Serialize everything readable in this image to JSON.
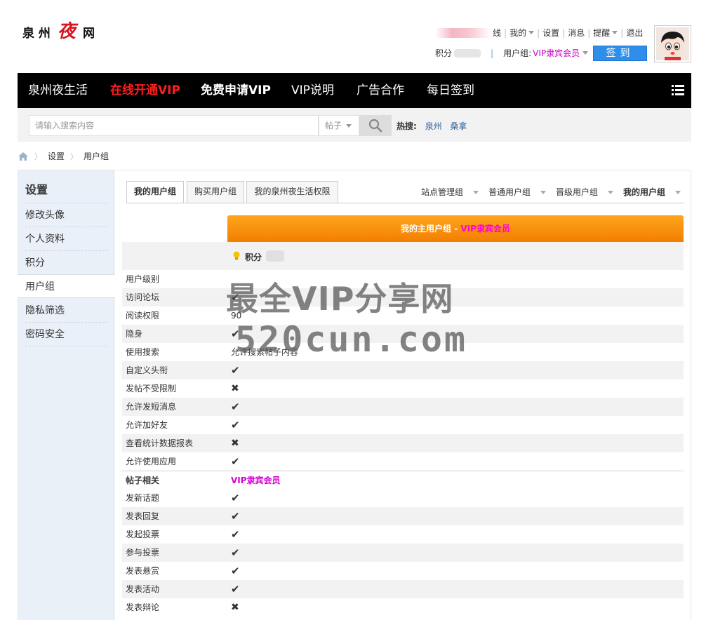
{
  "logo": {
    "part1": "泉 州",
    "part2": "夜",
    "part3": "网"
  },
  "usernav": {
    "online_suffix": "线",
    "items": [
      "我的",
      "设置",
      "消息",
      "提醒",
      "退出"
    ]
  },
  "userinfo": {
    "points_label": "积分",
    "group_label": "用户组: ",
    "group_value": "VIP隶宾会员",
    "signin_label": "签到"
  },
  "navbar": {
    "items": [
      "泉州夜生活",
      "在线开通VIP",
      "免费申请VIP",
      "VIP说明",
      "广告合作",
      "每日签到"
    ]
  },
  "search": {
    "placeholder": "请输入搜索内容",
    "type": "帖子",
    "hot_label": "热搜:",
    "hot_links": [
      "泉州",
      "桑拿"
    ]
  },
  "breadcrumb": [
    "设置",
    "用户组"
  ],
  "sidebar": {
    "title": "设置",
    "items": [
      "修改头像",
      "个人资料",
      "积分",
      "用户组",
      "隐私筛选",
      "密码安全"
    ]
  },
  "tabs": [
    "我的用户组",
    "购买用户组",
    "我的泉州夜生活权限"
  ],
  "group_links": [
    "站点管理组",
    "普通用户组",
    "晋级用户组",
    "我的用户组"
  ],
  "banner": {
    "prefix": "我的主用户组 - ",
    "vip": "VIP隶宾会员"
  },
  "points_label": "积分",
  "rows": [
    {
      "label": "用户级别",
      "value": ""
    },
    {
      "label": "访问论坛",
      "value": "check"
    },
    {
      "label": "阅读权限",
      "value": "90"
    },
    {
      "label": "隐身",
      "value": "check"
    },
    {
      "label": "使用搜索",
      "value": "允许搜索帖子内容"
    },
    {
      "label": "自定义头衔",
      "value": "check"
    },
    {
      "label": "发帖不受限制",
      "value": "cross"
    },
    {
      "label": "允许发短消息",
      "value": "check"
    },
    {
      "label": "允许加好友",
      "value": "check"
    },
    {
      "label": "查看统计数据报表",
      "value": "cross"
    },
    {
      "label": "允许使用应用",
      "value": "check"
    }
  ],
  "post_section": {
    "label": "帖子相关",
    "value": "VIP隶宾会员"
  },
  "post_rows": [
    {
      "label": "发新话题",
      "value": "check"
    },
    {
      "label": "发表回复",
      "value": "check"
    },
    {
      "label": "发起投票",
      "value": "check"
    },
    {
      "label": "参与投票",
      "value": "check"
    },
    {
      "label": "发表悬赏",
      "value": "check"
    },
    {
      "label": "发表活动",
      "value": "check"
    },
    {
      "label": "发表辩论",
      "value": "cross"
    }
  ],
  "watermark": {
    "line1": "最全VIP分享网",
    "line2": "520cun.com"
  },
  "colors": {
    "nav_bg": "#000000",
    "accent_blue": "#2f8eea",
    "vip_magenta": "#c600c6",
    "banner_orange": "#f68a0a",
    "check_green": "#5cb80c",
    "cross_red": "#e8534a"
  }
}
